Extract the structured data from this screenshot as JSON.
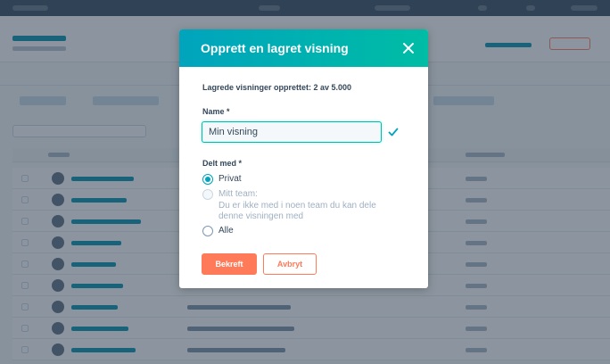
{
  "modal": {
    "title": "Opprett en lagret visning",
    "counter": "Lagrede visninger opprettet: 2 av 5.000",
    "name_label": "Name *",
    "name_value": "Min visning",
    "shared_label": "Delt med *",
    "options": [
      {
        "label": "Privat",
        "selected": true,
        "disabled": false
      },
      {
        "label": "Mitt team:",
        "hint_line1": "Du er ikke med i noen team du kan dele",
        "hint_line2": "denne visningen med",
        "selected": false,
        "disabled": true
      },
      {
        "label": "Alle",
        "selected": false,
        "disabled": false
      }
    ],
    "confirm_label": "Bekreft",
    "cancel_label": "Avbryt"
  },
  "colors": {
    "header_gradient_start": "#00a4bd",
    "header_gradient_end": "#00bda5",
    "primary_button": "#ff7a59",
    "valid_check": "#00a4bd",
    "overlay": "#2d3e50"
  },
  "icons": {
    "close": "close-icon",
    "valid": "checkmark-icon"
  }
}
